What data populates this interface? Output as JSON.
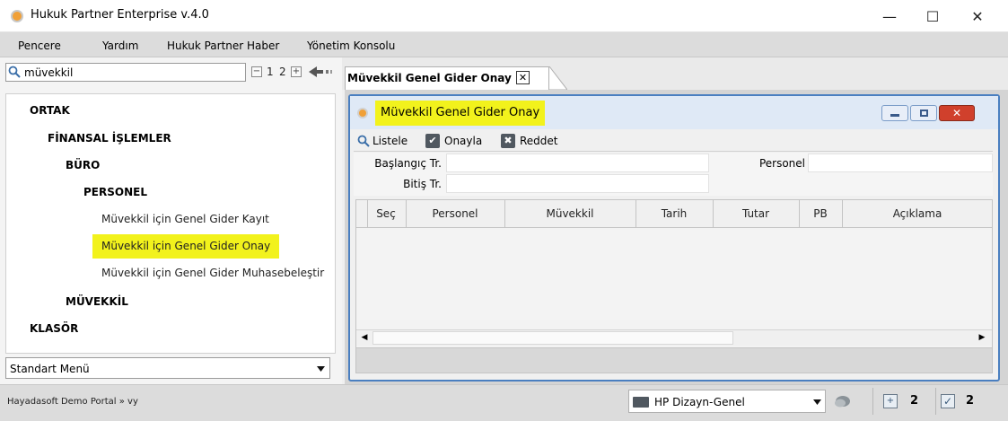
{
  "window": {
    "title": "Hukuk Partner Enterprise v.4.0",
    "minimize": "—",
    "maximize": "☐",
    "close": "✕"
  },
  "menubar": {
    "items": [
      "Pencere",
      "Yardım",
      "Hukuk Partner Haber",
      "Yönetim Konsolu"
    ]
  },
  "search": {
    "value": "müvekkil",
    "page1": "1",
    "page2": "2",
    "collapse": "−",
    "expand": "+"
  },
  "tree": {
    "ortak": "ORTAK",
    "finansal": "FİNANSAL İŞLEMLER",
    "buro": "BÜRO",
    "personel": "PERSONEL",
    "item1": "Müvekkil için Genel Gider Kayıt",
    "item2": "Müvekkil için Genel Gider Onay",
    "item3": "Müvekkil için Genel Gider Muhasebeleştir",
    "muvekkil": "MÜVEKKİL",
    "klasor": "KLASÖR"
  },
  "menu_select": {
    "value": "Standart Menü"
  },
  "tab": {
    "label": "Müvekkil Genel Gider Onay",
    "close": "✕"
  },
  "inner_window": {
    "title": "Müvekkil Genel Gider Onay"
  },
  "toolbar": {
    "listele": "Listele",
    "onayla": "Onayla",
    "reddet": "Reddet"
  },
  "form": {
    "baslangic": "Başlangıç Tr.",
    "bitis": "Bitiş Tr.",
    "personel": "Personel"
  },
  "grid": {
    "columns": [
      "Seç",
      "Personel",
      "Müvekkil",
      "Tarih",
      "Tutar",
      "PB",
      "Açıklama"
    ]
  },
  "status": {
    "breadcrumb": "Hayadasoft Demo Portal » vy",
    "profile": "HP Dizayn-Genel",
    "calendar_count": "2",
    "task_count": "2"
  },
  "colors": {
    "highlight": "#f2f21c",
    "window_border": "#4a7fc0",
    "close_red": "#d0402c"
  }
}
